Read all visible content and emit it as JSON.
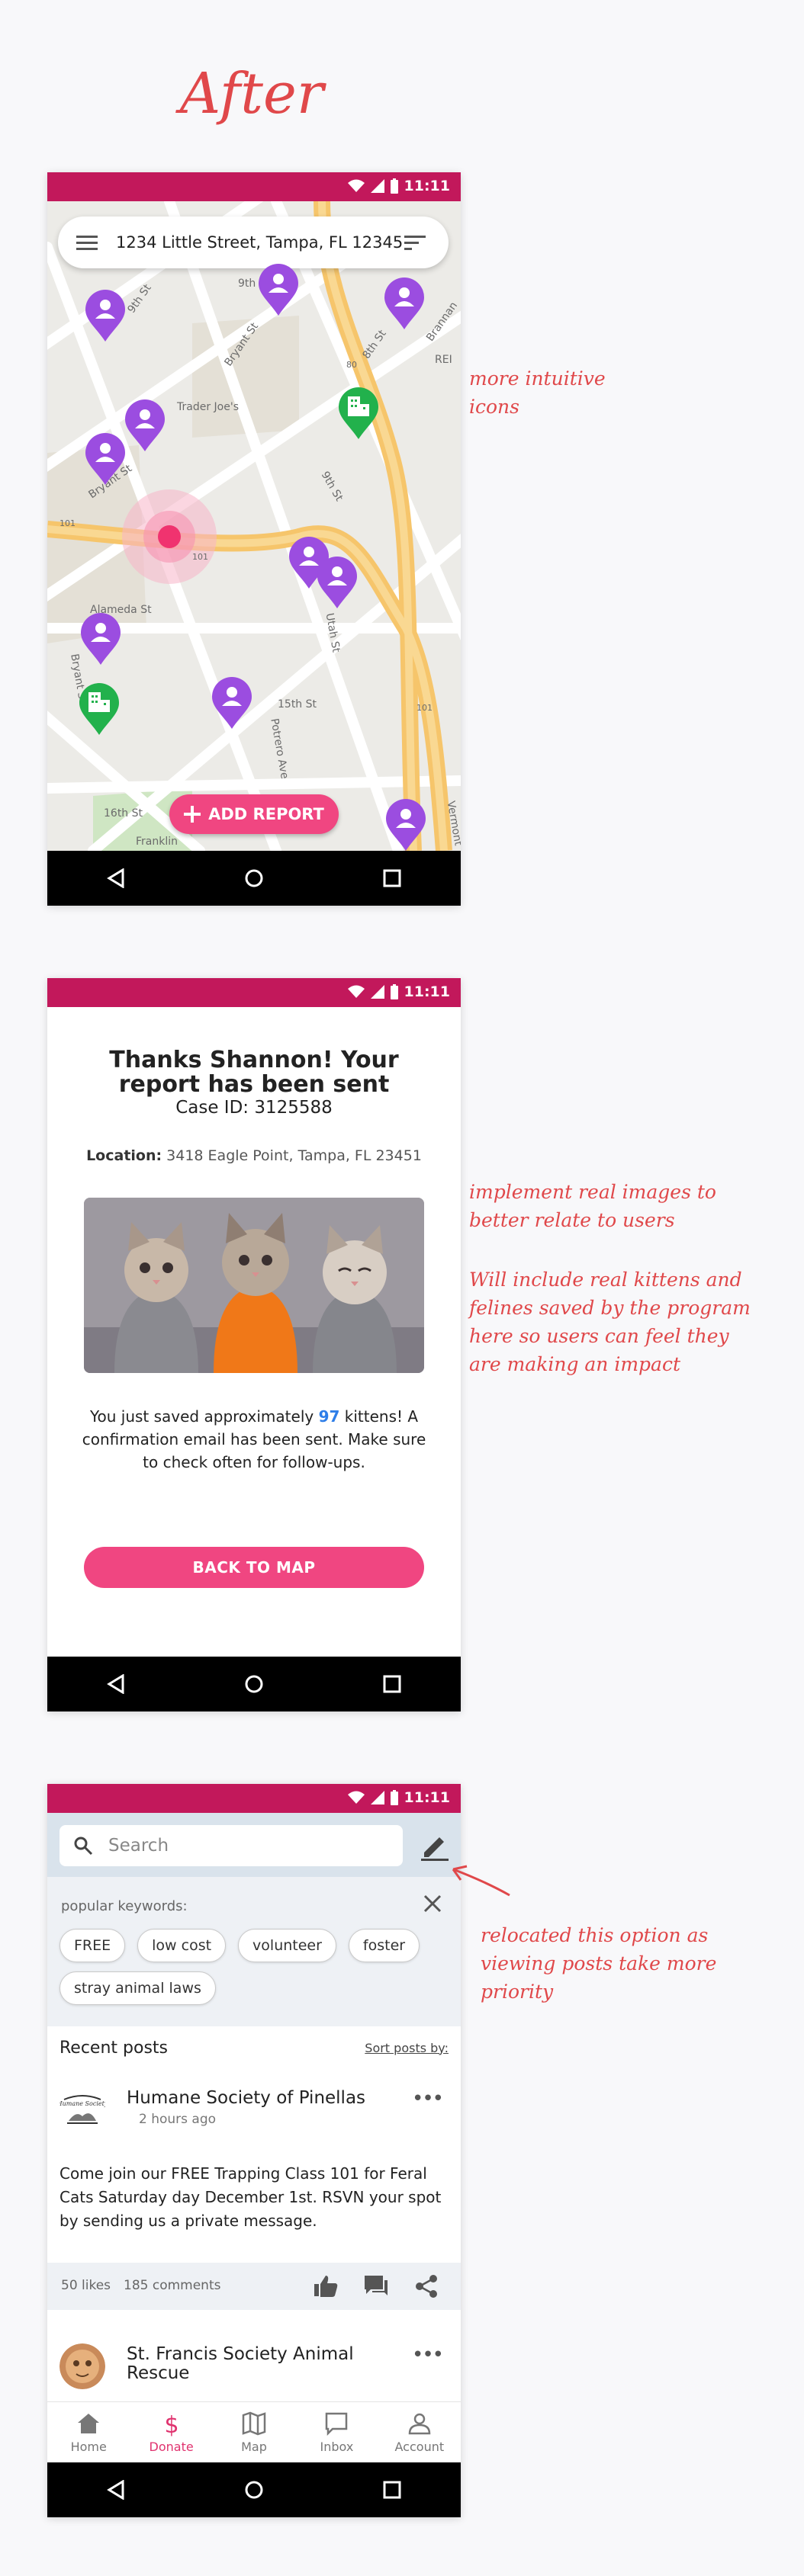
{
  "heading": "After",
  "status": {
    "time": "11:11"
  },
  "screen1": {
    "address": "1234 Little Street, Tampa, FL 12345",
    "add_report_label": "ADD REPORT",
    "map_labels": [
      "9th St",
      "9th St",
      "Bryant St",
      "8th St",
      "Brannan",
      "REI",
      "Trader Joe's",
      "Bryant St",
      "9th St",
      "101",
      "101",
      "Alameda St",
      "Bryant St",
      "Utah St",
      "15th St",
      "Potrero Ave",
      "101",
      "16th St",
      "Franklin",
      "Vermont",
      "80"
    ]
  },
  "screen2": {
    "title": "Thanks Shannon! Your report has been sent",
    "case_id": "Case ID: 3125588",
    "location_label": "Location:",
    "location_value": "3418 Eagle Point, Tampa, FL 23451",
    "body_prefix": "You just saved approximately",
    "kitten_count": "97",
    "body_suffix": "kittens! A confirmation email has been sent. Make sure to check often for follow-ups.",
    "back_label": "BACK TO MAP"
  },
  "screen3": {
    "search_placeholder": "Search",
    "keywords_label": "popular keywords:",
    "keywords": [
      "FREE",
      "low cost",
      "volunteer",
      "foster",
      "stray animal laws"
    ],
    "recent_title": "Recent posts",
    "sort_label": "Sort posts by:",
    "post1": {
      "author": "Humane Society of Pinellas",
      "time": "2 hours ago",
      "text": "Come join our FREE Trapping Class 101 for Feral Cats Saturday day December 1st. RSVN your spot by sending us a private message.",
      "likes": "50 likes",
      "comments": "185 comments",
      "logo_text": "Humane Society"
    },
    "post2": {
      "author": "St. Francis Society Animal Rescue"
    },
    "tabs": [
      "Home",
      "Donate",
      "Map",
      "Inbox",
      "Account"
    ]
  },
  "notes": {
    "note1": "more intuitive icons",
    "note2": "implement real images to better relate to users",
    "note3": "Will include real kittens and felines saved by the program here so users can feel they are making an impact",
    "note4": "relocated this option as viewing posts take more priority"
  },
  "colors": {
    "accent": "#f04681",
    "status_bar": "#c2185b",
    "annotation": "#e0484a",
    "pin_purple": "#9b4de0",
    "pin_green": "#22b14c",
    "link_blue": "#2e7ee8"
  }
}
